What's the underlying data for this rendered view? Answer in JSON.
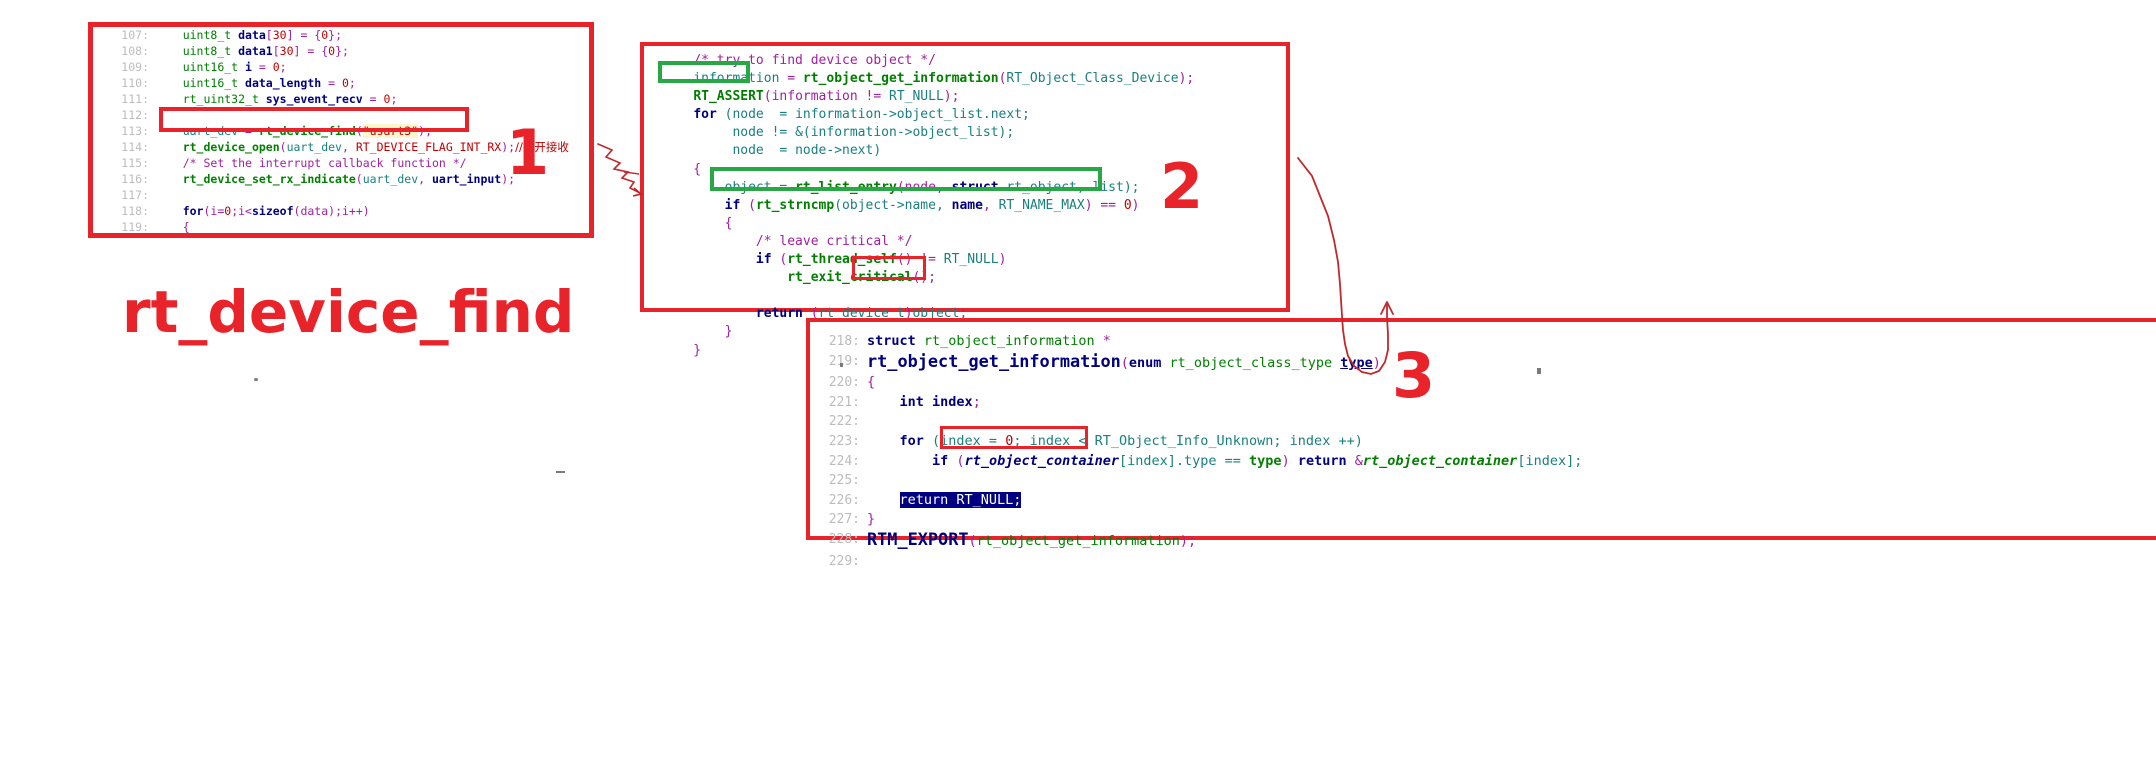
{
  "title": {
    "main_label": "rt_device_find"
  },
  "steps": [
    {
      "label": "1"
    },
    {
      "label": "2"
    },
    {
      "label": "3"
    }
  ],
  "panel1": {
    "name": "caller-code-panel",
    "lines": [
      {
        "no": "107",
        "tokens": [
          {
            "t": "    ",
            "c": "t-plain"
          },
          {
            "t": "uint8_t ",
            "c": "t-type"
          },
          {
            "t": "data",
            "c": "t-varb"
          },
          {
            "t": "[",
            "c": "t-punc"
          },
          {
            "t": "30",
            "c": "t-num"
          },
          {
            "t": "] = {",
            "c": "t-punc"
          },
          {
            "t": "0",
            "c": "t-num"
          },
          {
            "t": "};",
            "c": "t-punc"
          }
        ]
      },
      {
        "no": "108",
        "tokens": [
          {
            "t": "    ",
            "c": "t-plain"
          },
          {
            "t": "uint8_t ",
            "c": "t-type"
          },
          {
            "t": "data1",
            "c": "t-varb"
          },
          {
            "t": "[",
            "c": "t-punc"
          },
          {
            "t": "30",
            "c": "t-num"
          },
          {
            "t": "] = {",
            "c": "t-punc"
          },
          {
            "t": "0",
            "c": "t-num"
          },
          {
            "t": "};",
            "c": "t-punc"
          }
        ]
      },
      {
        "no": "109",
        "tokens": [
          {
            "t": "    ",
            "c": "t-plain"
          },
          {
            "t": "uint16_t ",
            "c": "t-type"
          },
          {
            "t": "i",
            "c": "t-varb"
          },
          {
            "t": " = ",
            "c": "t-punc"
          },
          {
            "t": "0",
            "c": "t-num"
          },
          {
            "t": ";",
            "c": "t-punc"
          }
        ]
      },
      {
        "no": "110",
        "tokens": [
          {
            "t": "    ",
            "c": "t-plain"
          },
          {
            "t": "uint16_t ",
            "c": "t-type"
          },
          {
            "t": "data_length",
            "c": "t-varb"
          },
          {
            "t": " = ",
            "c": "t-punc"
          },
          {
            "t": "0",
            "c": "t-num"
          },
          {
            "t": ";",
            "c": "t-punc"
          }
        ]
      },
      {
        "no": "111",
        "tokens": [
          {
            "t": "    ",
            "c": "t-plain"
          },
          {
            "t": "rt_uint32_t ",
            "c": "t-type"
          },
          {
            "t": "sys_event_recv",
            "c": "t-varb"
          },
          {
            "t": " = ",
            "c": "t-punc"
          },
          {
            "t": "0",
            "c": "t-num"
          },
          {
            "t": ";",
            "c": "t-punc"
          }
        ]
      },
      {
        "no": "112",
        "tokens": []
      },
      {
        "no": "113",
        "tokens": [
          {
            "t": "    ",
            "c": "t-plain"
          },
          {
            "t": "uart_dev",
            "c": "t-var"
          },
          {
            "t": " = ",
            "c": "t-punc"
          },
          {
            "t": "rt_device_find",
            "c": "t-fn"
          },
          {
            "t": "(",
            "c": "t-punc"
          },
          {
            "t": "\"usart3\"",
            "c": "t-str"
          },
          {
            "t": ");",
            "c": "t-punc"
          }
        ]
      },
      {
        "no": "114",
        "tokens": [
          {
            "t": "    ",
            "c": "t-plain"
          },
          {
            "t": "rt_device_open",
            "c": "t-fn"
          },
          {
            "t": "(",
            "c": "t-punc"
          },
          {
            "t": "uart_dev",
            "c": "t-var"
          },
          {
            "t": ", ",
            "c": "t-punc"
          },
          {
            "t": "RT_DEVICE_FLAG_INT_RX",
            "c": "t-macro"
          },
          {
            "t": ");",
            "c": "t-punc"
          },
          {
            "t": "//打开接收",
            "c": "t-cn"
          }
        ]
      },
      {
        "no": "115",
        "tokens": [
          {
            "t": "    ",
            "c": "t-plain"
          },
          {
            "t": "/* Set the interrupt callback function */",
            "c": "t-cmt"
          }
        ]
      },
      {
        "no": "116",
        "tokens": [
          {
            "t": "    ",
            "c": "t-plain"
          },
          {
            "t": "rt_device_set_rx_indicate",
            "c": "t-fn"
          },
          {
            "t": "(",
            "c": "t-punc"
          },
          {
            "t": "uart_dev",
            "c": "t-var"
          },
          {
            "t": ", ",
            "c": "t-punc"
          },
          {
            "t": "uart_input",
            "c": "t-varb"
          },
          {
            "t": ");",
            "c": "t-punc"
          }
        ]
      },
      {
        "no": "117",
        "tokens": []
      },
      {
        "no": "118",
        "tokens": [
          {
            "t": "    ",
            "c": "t-plain"
          },
          {
            "t": "for",
            "c": "t-kw"
          },
          {
            "t": "(i=",
            "c": "t-punc"
          },
          {
            "t": "0",
            "c": "t-num"
          },
          {
            "t": ";i<",
            "c": "t-punc"
          },
          {
            "t": "sizeof",
            "c": "t-kw"
          },
          {
            "t": "(data);i++)",
            "c": "t-punc"
          }
        ]
      },
      {
        "no": "119",
        "tokens": [
          {
            "t": "    {",
            "c": "t-brace"
          }
        ]
      }
    ]
  },
  "panel2": {
    "name": "rt-device-find-body-panel",
    "lines": [
      {
        "tokens": [
          {
            "t": "    ",
            "c": "t-plain"
          },
          {
            "t": "/* try to find device object */",
            "c": "t-cmt"
          }
        ]
      },
      {
        "tokens": [
          {
            "t": "    ",
            "c": "t-plain"
          },
          {
            "t": "information",
            "c": "t-var"
          },
          {
            "t": " = ",
            "c": "t-punc"
          },
          {
            "t": "rt_object_get_information",
            "c": "t-fn"
          },
          {
            "t": "(",
            "c": "t-punc"
          },
          {
            "t": "RT_Object_Class_Device",
            "c": "t-var"
          },
          {
            "t": ");",
            "c": "t-punc"
          }
        ]
      },
      {
        "tokens": [
          {
            "t": "    ",
            "c": "t-plain"
          },
          {
            "t": "RT_ASSERT",
            "c": "t-fn"
          },
          {
            "t": "(information != ",
            "c": "t-punc"
          },
          {
            "t": "RT_NULL",
            "c": "t-var"
          },
          {
            "t": ");",
            "c": "t-punc"
          }
        ]
      },
      {
        "tokens": [
          {
            "t": "    ",
            "c": "t-plain"
          },
          {
            "t": "for",
            "c": "t-kw"
          },
          {
            "t": " (node  = information->object_list.next;",
            "c": "t-var"
          }
        ]
      },
      {
        "tokens": [
          {
            "t": "         ",
            "c": "t-plain"
          },
          {
            "t": "node != &(information->object_list);",
            "c": "t-var"
          }
        ]
      },
      {
        "tokens": [
          {
            "t": "         ",
            "c": "t-plain"
          },
          {
            "t": "node  = node->next)",
            "c": "t-var"
          }
        ]
      },
      {
        "tokens": [
          {
            "t": "    {",
            "c": "t-brace"
          }
        ]
      },
      {
        "tokens": [
          {
            "t": "        ",
            "c": "t-plain"
          },
          {
            "t": "object = ",
            "c": "t-var"
          },
          {
            "t": "rt_list_entry",
            "c": "t-fn"
          },
          {
            "t": "(node, ",
            "c": "t-punc"
          },
          {
            "t": "struct",
            "c": "t-kw"
          },
          {
            "t": " rt_object, list);",
            "c": "t-var"
          }
        ]
      },
      {
        "tokens": [
          {
            "t": "        ",
            "c": "t-plain"
          },
          {
            "t": "if",
            "c": "t-kw"
          },
          {
            "t": " (",
            "c": "t-punc"
          },
          {
            "t": "rt_strncmp",
            "c": "t-fn"
          },
          {
            "t": "(object->name, ",
            "c": "t-var"
          },
          {
            "t": "name",
            "c": "t-varb"
          },
          {
            "t": ", ",
            "c": "t-punc"
          },
          {
            "t": "RT_NAME_MAX",
            "c": "t-var"
          },
          {
            "t": ") == ",
            "c": "t-punc"
          },
          {
            "t": "0",
            "c": "t-num"
          },
          {
            "t": ")",
            "c": "t-punc"
          }
        ]
      },
      {
        "tokens": [
          {
            "t": "        {",
            "c": "t-brace"
          }
        ]
      },
      {
        "tokens": [
          {
            "t": "            ",
            "c": "t-plain"
          },
          {
            "t": "/* leave critical */",
            "c": "t-cmt"
          }
        ]
      },
      {
        "tokens": [
          {
            "t": "            ",
            "c": "t-plain"
          },
          {
            "t": "if",
            "c": "t-kw"
          },
          {
            "t": " (",
            "c": "t-punc"
          },
          {
            "t": "rt_thread_self",
            "c": "t-fn"
          },
          {
            "t": "() != ",
            "c": "t-punc"
          },
          {
            "t": "RT_NULL",
            "c": "t-var"
          },
          {
            "t": ")",
            "c": "t-punc"
          }
        ]
      },
      {
        "tokens": [
          {
            "t": "                ",
            "c": "t-plain"
          },
          {
            "t": "rt_exit_critical",
            "c": "t-fn"
          },
          {
            "t": "();",
            "c": "t-punc"
          }
        ]
      },
      {
        "tokens": []
      },
      {
        "tokens": [
          {
            "t": "            ",
            "c": "t-plain"
          },
          {
            "t": "return",
            "c": "t-kw"
          },
          {
            "t": " (",
            "c": "t-punc"
          },
          {
            "t": "rt_device_t",
            "c": "t-var"
          },
          {
            "t": ")",
            "c": "t-punc"
          },
          {
            "t": "object",
            "c": "t-var"
          },
          {
            "t": ";",
            "c": "t-punc"
          }
        ]
      },
      {
        "tokens": [
          {
            "t": "        }",
            "c": "t-brace"
          }
        ]
      },
      {
        "tokens": [
          {
            "t": "    }",
            "c": "t-brace"
          }
        ]
      }
    ]
  },
  "panel3": {
    "name": "rt-object-get-information-panel",
    "lines": [
      {
        "no": "218",
        "tokens": [
          {
            "t": "struct",
            "c": "t-kw"
          },
          {
            "t": " rt_object_information ",
            "c": "t-type"
          },
          {
            "t": "*",
            "c": "t-punc"
          }
        ]
      },
      {
        "no": "219",
        "tokens": [
          {
            "t": "rt_object_get_information",
            "c": "t-fn-big"
          },
          {
            "t": "(",
            "c": "t-punc"
          },
          {
            "t": "enum",
            "c": "t-kw"
          },
          {
            "t": " rt_object_class_type ",
            "c": "t-type"
          },
          {
            "t": "type",
            "c": "t-u-var"
          },
          {
            "t": ")",
            "c": "t-punc"
          }
        ]
      },
      {
        "no": "220",
        "tokens": [
          {
            "t": "{",
            "c": "t-brace"
          }
        ]
      },
      {
        "no": "221",
        "tokens": [
          {
            "t": "    ",
            "c": "t-plain"
          },
          {
            "t": "int",
            "c": "t-kw"
          },
          {
            "t": " ",
            "c": "t-plain"
          },
          {
            "t": "index",
            "c": "t-varb"
          },
          {
            "t": ";",
            "c": "t-punc"
          }
        ]
      },
      {
        "no": "222",
        "tokens": []
      },
      {
        "no": "223",
        "tokens": [
          {
            "t": "    ",
            "c": "t-plain"
          },
          {
            "t": "for",
            "c": "t-kw"
          },
          {
            "t": " (index = ",
            "c": "t-var"
          },
          {
            "t": "0",
            "c": "t-num"
          },
          {
            "t": "; index < ",
            "c": "t-var"
          },
          {
            "t": "RT_Object_Info_Unknown",
            "c": "t-var"
          },
          {
            "t": "; index ++)",
            "c": "t-var"
          }
        ]
      },
      {
        "no": "224",
        "tokens": [
          {
            "t": "        ",
            "c": "t-plain"
          },
          {
            "t": "if",
            "c": "t-kw"
          },
          {
            "t": " (",
            "c": "t-punc"
          },
          {
            "t": "rt_object_container",
            "c": "t-ital"
          },
          {
            "t": "[index].type == ",
            "c": "t-var"
          },
          {
            "t": "type",
            "c": "t-typeb"
          },
          {
            "t": ") ",
            "c": "t-punc"
          },
          {
            "t": "return",
            "c": "t-kw"
          },
          {
            "t": " &",
            "c": "t-punc"
          },
          {
            "t": "rt_object_container",
            "c": "t-ital2"
          },
          {
            "t": "[index];",
            "c": "t-var"
          }
        ]
      },
      {
        "no": "225",
        "tokens": []
      },
      {
        "no": "226",
        "tokens": [
          {
            "t": "    ",
            "c": "t-plain"
          },
          {
            "t": "return RT_NULL;",
            "c": "t-sel"
          }
        ]
      },
      {
        "no": "227",
        "tokens": [
          {
            "t": "}",
            "c": "t-brace"
          }
        ]
      },
      {
        "no": "228",
        "tokens": [
          {
            "t": "RTM_EXPORT",
            "c": "t-fn-big"
          },
          {
            "t": "(",
            "c": "t-punc"
          },
          {
            "t": "rt_object_get_information",
            "c": "t-type"
          },
          {
            "t": ");",
            "c": "t-punc"
          }
        ]
      },
      {
        "no": "229",
        "tokens": []
      }
    ]
  },
  "annotations": {
    "highlight_color_red": "#e8232a",
    "highlight_color_green": "#28a745",
    "selection_color": "#000080"
  }
}
